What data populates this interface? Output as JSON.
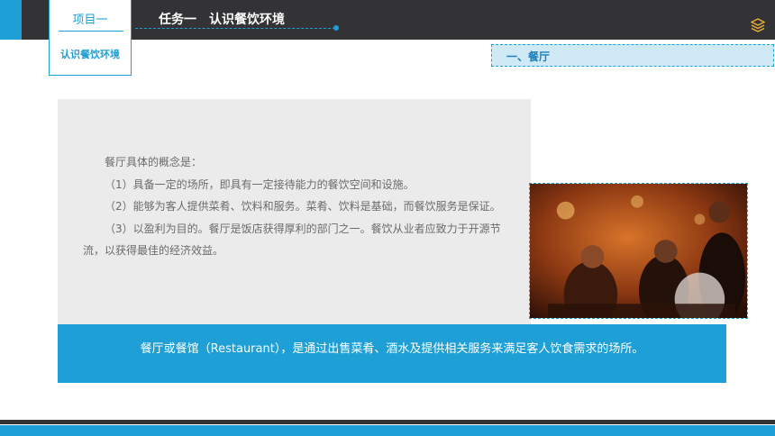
{
  "header": {
    "project_label": "项目一",
    "project_sub": "认识餐饮环境",
    "task_title": "任务一　认识餐饮环境",
    "logo_icon": "layers-logo-icon"
  },
  "section": {
    "label": "一、餐厅"
  },
  "content": {
    "lines": [
      "餐厅具体的概念是：",
      "（1）具备一定的场所，即具有一定接待能力的餐饮空间和设施。",
      "（2）能够为客人提供菜肴、饮料和服务。菜肴、饮料是基础，而餐饮服务是保证。",
      "（3）以盈利为目的。餐厅是饭店获得厚利的部门之一。餐饮从业者应致力于开源节流，以获得最佳的经济效益。"
    ]
  },
  "definition": "餐厅或餐馆（Restaurant），是通过出售菜肴、酒水及提供相关服务来满足客人饮食需求的场所。",
  "colors": {
    "accent": "#1e9fd6",
    "dark": "#333336",
    "panel": "#ebebeb"
  }
}
